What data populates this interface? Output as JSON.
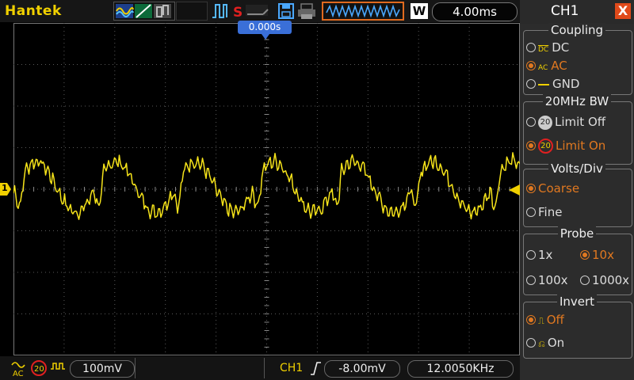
{
  "topbar": {
    "brand": "Hantek",
    "timebase": "4.00ms",
    "acq_mode": "W",
    "run_state_letter": "S"
  },
  "display": {
    "trigger_position": "0.000s",
    "channel_marker": "1",
    "trace_color": "#f5e31a",
    "grid_color": "#5a5a5a"
  },
  "bottombar": {
    "coupling_icon": "ac-coupling-icon",
    "bw_icon": "20",
    "volts_div": "100mV",
    "trigger_source": "CH1",
    "trigger_level": "-8.00mV",
    "frequency": "12.0050KHz"
  },
  "panel": {
    "title": "CH1",
    "close": "X",
    "coupling": {
      "title": "Coupling",
      "options": [
        "DC",
        "AC",
        "GND"
      ],
      "icons": [
        "DC",
        "AC",
        ""
      ],
      "selected": "AC"
    },
    "bandwidth": {
      "title": "20MHz BW",
      "icon": "20",
      "options": [
        "Limit Off",
        "Limit On"
      ],
      "selected": "Limit On"
    },
    "volts_div": {
      "title": "Volts/Div",
      "options": [
        "Coarse",
        "Fine"
      ],
      "selected": "Coarse"
    },
    "probe": {
      "title": "Probe",
      "options": [
        "1x",
        "10x",
        "100x",
        "1000x"
      ],
      "selected": "10x"
    },
    "invert": {
      "title": "Invert",
      "options": [
        "Off",
        "On"
      ],
      "selected": "Off"
    }
  },
  "colors": {
    "brand": "#f0d000",
    "accent": "#e07820",
    "close": "#e04a1a",
    "trigger_marker": "#3a6fd8",
    "trace": "#f5e31a"
  }
}
